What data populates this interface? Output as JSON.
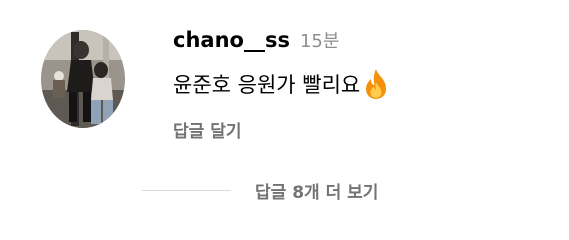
{
  "comment": {
    "username": "chano__ss",
    "time": "15분",
    "text": "윤준호 응원가 빨리요",
    "emoji_icon": "fire-icon",
    "reply_label": "답글 달기"
  },
  "replies": {
    "view_label": "답글 8개 더 보기"
  },
  "colors": {
    "primary_text": "#000000",
    "secondary_text": "#737373",
    "time_text": "#8e8e8e",
    "divider": "#dbdbdb",
    "fire_outer": "#f4900c",
    "fire_inner": "#ffcc4d"
  }
}
